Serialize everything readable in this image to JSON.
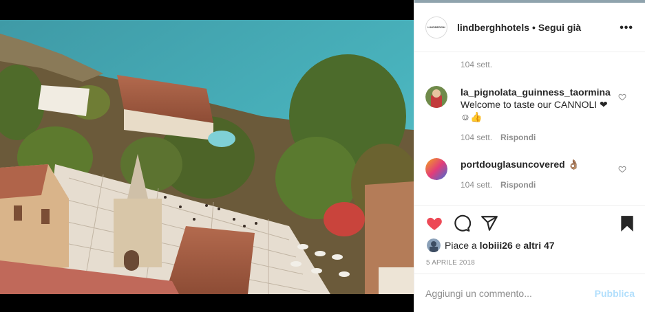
{
  "post": {
    "username": "lindberghhotels",
    "separator": "•",
    "follow_state": "Segui già",
    "more_glyph": "•••",
    "logo_text": "LINDBERGH"
  },
  "comments": {
    "first_meta_time": "104 sett.",
    "items": [
      {
        "username": "la_pignolata_guinness_taormina",
        "text": "Welcome to taste our CANNOLI ❤☺👍",
        "time": "104 sett.",
        "reply_label": "Rispondi"
      },
      {
        "username": "portdouglasuncovered",
        "text": "👌🏽",
        "time": "104 sett.",
        "reply_label": "Rispondi"
      }
    ]
  },
  "actions": {
    "likes_prefix": "Piace a",
    "likes_user": "lobiii26",
    "likes_conjunction": "e",
    "likes_others": "altri 47",
    "date": "5 APRILE 2018",
    "icons": [
      "heart-icon",
      "comment-icon",
      "share-icon",
      "bookmark-icon"
    ]
  },
  "add_comment": {
    "placeholder": "Aggiungi un commento...",
    "publish_label": "Pubblica"
  },
  "colors": {
    "like_red": "#ed4956",
    "publish_blue": "#b2dffc",
    "meta_grey": "#8e8e8e",
    "text": "#262626"
  }
}
